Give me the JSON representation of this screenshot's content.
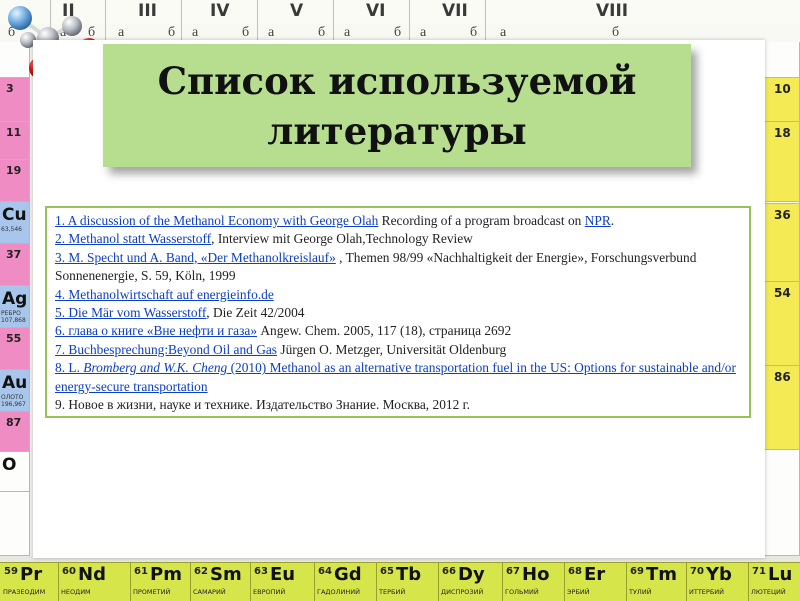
{
  "background": {
    "group_headers": [
      "II",
      "III",
      "IV",
      "V",
      "VI",
      "VII",
      "VIII"
    ],
    "subgroup_labels": [
      "б",
      "а",
      "б",
      "а",
      "б",
      "а",
      "б",
      "а",
      "б",
      "а",
      "б",
      "а",
      "б",
      "а",
      "б"
    ],
    "left_column": [
      {
        "num": "3"
      },
      {
        "num": "11"
      },
      {
        "num": "19"
      },
      {
        "sym": "Cu",
        "note": "63,546"
      },
      {
        "num": "37"
      },
      {
        "sym": "Ag",
        "note": "РЕБРО 107,868"
      },
      {
        "num": "55"
      },
      {
        "sym": "Au",
        "note": "ОЛОТО 196,967"
      },
      {
        "num": "87"
      },
      {
        "sym": "О"
      }
    ],
    "right_column": [
      {
        "num": "10"
      },
      {
        "num": "18"
      },
      {
        "num": "36"
      },
      {
        "num": "54"
      },
      {
        "num": "86"
      }
    ],
    "lanthanides": [
      {
        "num": "59",
        "sym": "Pr",
        "name": "ПРАЗЕОДИМ"
      },
      {
        "num": "60",
        "sym": "Nd",
        "name": "НЕОДИМ"
      },
      {
        "num": "61",
        "sym": "Pm",
        "name": "ПРОМЕТИЙ"
      },
      {
        "num": "62",
        "sym": "Sm",
        "name": "САМАРИЙ"
      },
      {
        "num": "63",
        "sym": "Eu",
        "name": "ЕВРОПИЙ"
      },
      {
        "num": "64",
        "sym": "Gd",
        "name": "ГАДОЛИНИЙ"
      },
      {
        "num": "65",
        "sym": "Tb",
        "name": "ТЕРБИЙ"
      },
      {
        "num": "66",
        "sym": "Dy",
        "name": "ДИСПРОЗИЙ"
      },
      {
        "num": "67",
        "sym": "Ho",
        "name": "ГОЛЬМИЙ"
      },
      {
        "num": "68",
        "sym": "Er",
        "name": "ЭРБИЙ"
      },
      {
        "num": "69",
        "sym": "Tm",
        "name": "ТУЛИЙ"
      },
      {
        "num": "70",
        "sym": "Yb",
        "name": "ИТТЕРБИЙ"
      },
      {
        "num": "71",
        "sym": "Lu",
        "name": "ЛЮТЕЦИЙ"
      }
    ]
  },
  "slide": {
    "title": "Список используемой литературы",
    "references": [
      {
        "link": "1. A discussion of the Methanol Economy with George Olah",
        "text": " Recording of a program broadcast on ",
        "link2": "NPR",
        "tail": "."
      },
      {
        "link": "2. Methanol statt Wasserstoff",
        "text": ", Interview mit George Olah,Technology Review"
      },
      {
        "link": "3. M. Specht und A. Band, «Der Methanolkreislauf»",
        "text": " , Themen 98/99 «Nachhaltigkeit der Energie», Forschungsverbund Sonnenenergie, S. 59, Köln, 1999"
      },
      {
        "link": "4. Methanolwirtschaft auf energieinfo.de"
      },
      {
        "link": "5. Die Mär vom Wasserstoff",
        "text": ", Die Zeit 42/2004"
      },
      {
        "link": "6. глава о книге «Вне нефти и газа»",
        "text": " Angew. Chem. 2005, 117 (18), страница 2692"
      },
      {
        "link": "7. Buchbesprechung:Beyond Oil and Gas",
        "text": " Jürgen O. Metzger, Universität Oldenburg"
      },
      {
        "link_prefix": "8. L. ",
        "link_italic": "Bromberg and W.K. Cheng",
        "link": " (2010) Methanol as an alternative transportation fuel in the US: Options for sustainable and/or energy-secure transportation"
      },
      {
        "text": "9. Новое в жизни, науке и технике. Издательство Знание. Москва, 2012 г."
      }
    ]
  },
  "colors": {
    "title_box": "#b7dd8f",
    "refs_border": "#95c35a",
    "link": "#0b3ec9",
    "s_block": "#f08cc4",
    "d_block": "#a8c6ec",
    "p_block": "#f3ea54",
    "f_block": "#d6e64a"
  },
  "icons": [
    "molecule-logo-icon"
  ]
}
